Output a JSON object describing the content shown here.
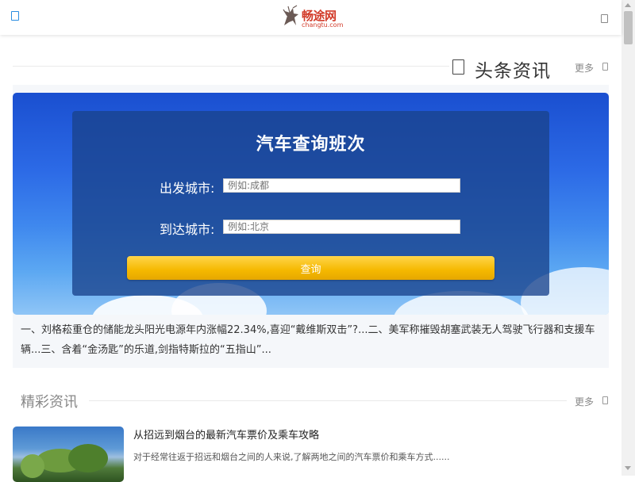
{
  "header": {
    "logo_text": "畅途网",
    "logo_domain": "changtu.com"
  },
  "headline_section": {
    "title": "头条资讯",
    "more_label": "更多"
  },
  "search_panel": {
    "title": "汽车查询班次",
    "departure_label": "出发城市:",
    "departure_placeholder": "例如:成都",
    "arrival_label": "到达城市:",
    "arrival_placeholder": "例如:北京",
    "submit_label": "查询"
  },
  "news_summary": "一、刘格菘重仓的储能龙头阳光电源年内涨幅22.34%,喜迎“戴维斯双击”?...二、美军称摧毁胡塞武装无人驾驶飞行器和支援车辆...三、含着“金汤匙”的乐道,剑指特斯拉的“五指山”...",
  "featured_section": {
    "title": "精彩资讯",
    "more_label": "更多"
  },
  "articles": [
    {
      "title": "从招远到烟台的最新汽车票价及乘车攻略",
      "description": "对于经常往返于招远和烟台之间的人来说,了解两地之间的汽车票价和乘车方式......"
    }
  ],
  "colors": {
    "accent_blue": "#2a8de0",
    "brand_red": "#d23b2a",
    "button_yellow": "#f5b800"
  },
  "icons": [
    "menu-icon",
    "user-icon",
    "news-icon",
    "chevron-right-icon"
  ]
}
